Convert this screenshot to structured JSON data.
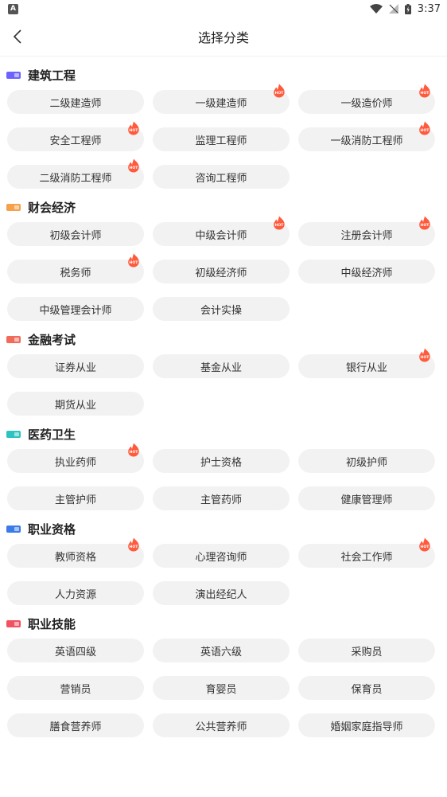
{
  "status_bar": {
    "time": "3:37",
    "left_icon": "A"
  },
  "nav": {
    "title": "选择分类",
    "back_icon": "chevron-left-icon"
  },
  "colors": {
    "hot": "#ff5a3c",
    "chip_bg": "#f2f2f2"
  },
  "sections": [
    {
      "title": "建筑工程",
      "icon_color": "#6c63ff",
      "items": [
        {
          "label": "二级建造师",
          "hot": false
        },
        {
          "label": "一级建造师",
          "hot": true
        },
        {
          "label": "一级造价师",
          "hot": true
        },
        {
          "label": "安全工程师",
          "hot": true
        },
        {
          "label": "监理工程师",
          "hot": false
        },
        {
          "label": "一级消防工程师",
          "hot": true
        },
        {
          "label": "二级消防工程师",
          "hot": true
        },
        {
          "label": "咨询工程师",
          "hot": false
        }
      ]
    },
    {
      "title": "财会经济",
      "icon_color": "#f5a04a",
      "items": [
        {
          "label": "初级会计师",
          "hot": false
        },
        {
          "label": "中级会计师",
          "hot": true
        },
        {
          "label": "注册会计师",
          "hot": true
        },
        {
          "label": "税务师",
          "hot": true
        },
        {
          "label": "初级经济师",
          "hot": false
        },
        {
          "label": "中级经济师",
          "hot": false
        },
        {
          "label": "中级管理会计师",
          "hot": false
        },
        {
          "label": "会计实操",
          "hot": false
        }
      ]
    },
    {
      "title": "金融考试",
      "icon_color": "#f06b5b",
      "items": [
        {
          "label": "证券从业",
          "hot": false
        },
        {
          "label": "基金从业",
          "hot": false
        },
        {
          "label": "银行从业",
          "hot": true
        },
        {
          "label": "期货从业",
          "hot": false
        }
      ]
    },
    {
      "title": "医药卫生",
      "icon_color": "#2cc3c0",
      "items": [
        {
          "label": "执业药师",
          "hot": true
        },
        {
          "label": "护士资格",
          "hot": false
        },
        {
          "label": "初级护师",
          "hot": false
        },
        {
          "label": "主管护师",
          "hot": false
        },
        {
          "label": "主管药师",
          "hot": false
        },
        {
          "label": "健康管理师",
          "hot": false
        }
      ]
    },
    {
      "title": "职业资格",
      "icon_color": "#3b7be8",
      "items": [
        {
          "label": "教师资格",
          "hot": true
        },
        {
          "label": "心理咨询师",
          "hot": false
        },
        {
          "label": "社会工作师",
          "hot": true
        },
        {
          "label": "人力资源",
          "hot": false
        },
        {
          "label": "演出经纪人",
          "hot": false
        }
      ]
    },
    {
      "title": "职业技能",
      "icon_color": "#f05262",
      "items": [
        {
          "label": "英语四级",
          "hot": false
        },
        {
          "label": "英语六级",
          "hot": false
        },
        {
          "label": "采购员",
          "hot": false
        },
        {
          "label": "营销员",
          "hot": false
        },
        {
          "label": "育婴员",
          "hot": false
        },
        {
          "label": "保育员",
          "hot": false
        },
        {
          "label": "膳食营养师",
          "hot": false
        },
        {
          "label": "公共营养师",
          "hot": false
        },
        {
          "label": "婚姻家庭指导师",
          "hot": false
        }
      ]
    }
  ]
}
